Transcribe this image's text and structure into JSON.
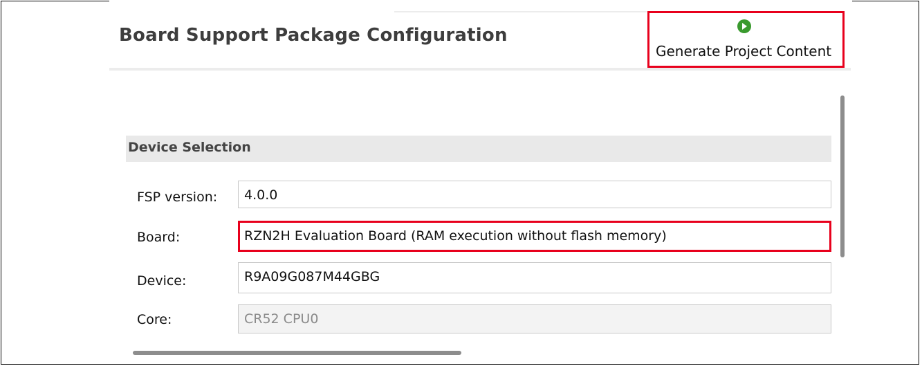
{
  "header": {
    "title": "Board Support Package Configuration",
    "generate_label": "Generate Project Content"
  },
  "device_selection": {
    "section_label": "Device Selection",
    "fsp_version": {
      "label": "FSP version:",
      "value": "4.0.0"
    },
    "board": {
      "label": "Board:",
      "value": "RZN2H Evaluation Board (RAM execution without flash memory)"
    },
    "device": {
      "label": "Device:",
      "value": "R9A09G087M44GBG"
    },
    "core": {
      "label": "Core:",
      "value": "CR52 CPU0"
    }
  },
  "colors": {
    "highlight": "#e8001c",
    "run_icon": "#3a9a2e"
  },
  "icons": {
    "generate": "run-icon"
  }
}
